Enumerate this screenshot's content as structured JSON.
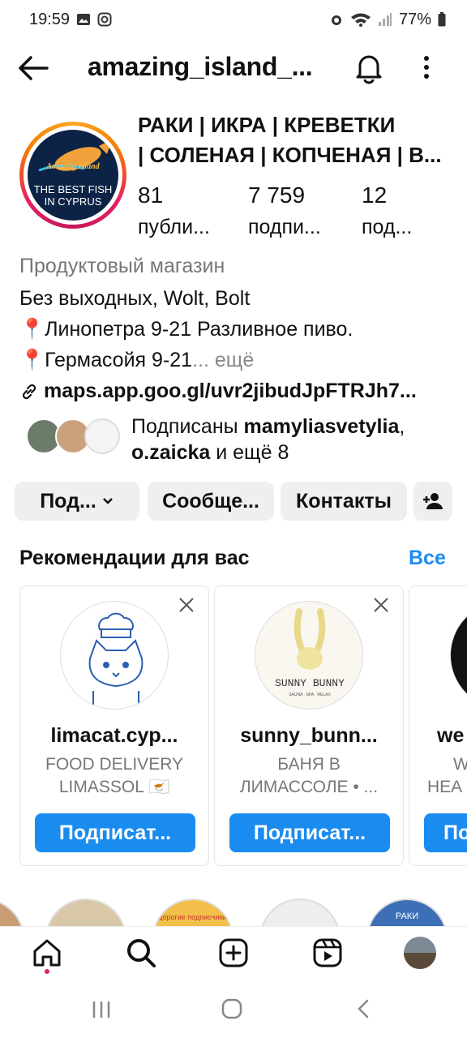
{
  "status": {
    "time": "19:59",
    "battery": "77%"
  },
  "header": {
    "username": "amazing_island_..."
  },
  "profile": {
    "name_line1": "РАКИ | ИКРА | КРЕВЕТКИ",
    "name_line2": "| СОЛЕНАЯ |  КОПЧЕНАЯ | В...",
    "avatar_text_line1": "THE BEST FISH",
    "avatar_text_line2": "IN CYPRUS",
    "avatar_brand": "Amazing Island",
    "stats": [
      {
        "num": "81",
        "label": "публи..."
      },
      {
        "num": "7 759",
        "label": "подпи..."
      },
      {
        "num": "12",
        "label": "под..."
      }
    ],
    "category": "Продуктовый магазин",
    "bio_line1": "Без выходных, Wolt, Bolt",
    "bio_line2": "📍Линопетра 9-21 Разливное пиво.",
    "bio_line3": "📍Гермасойя 9-21",
    "bio_more": "... ещё",
    "link": "maps.app.goo.gl/uvr2jibudJpFTRJh7...",
    "followed_prefix": "Подписаны ",
    "followed_user1": "mamyliasvetylia",
    "followed_comma": ",",
    "followed_user2": "o.zaicka",
    "followed_suffix": " и ещё 8"
  },
  "buttons": {
    "follow": "Под...",
    "message": "Сообще...",
    "contacts": "Контакты"
  },
  "recommendations": {
    "title": "Рекомендации для вас",
    "see_all": "Все",
    "cards": [
      {
        "name": "limacat.cyp...",
        "sub1": "FOOD DELIVERY",
        "sub2": "LIMASSOL 🇨🇾",
        "button": "Подписат..."
      },
      {
        "name": "sunny_bunn...",
        "sub1": "БАНЯ В",
        "sub2": "ЛИМАССОЛЕ • ...",
        "button": "Подписат...",
        "logo_text": "SUNNY BUNNY",
        "logo_sub": "SAUNA · SPA · RELAX"
      },
      {
        "name": "we",
        "sub1": "W",
        "sub2": "HEA",
        "button": "По"
      }
    ]
  },
  "highlights": {
    "item3": "Дорогие подписчики!",
    "item5": "РАКИ"
  },
  "colors": {
    "accent": "#1a8cf0",
    "button_bg": "#efefef"
  }
}
